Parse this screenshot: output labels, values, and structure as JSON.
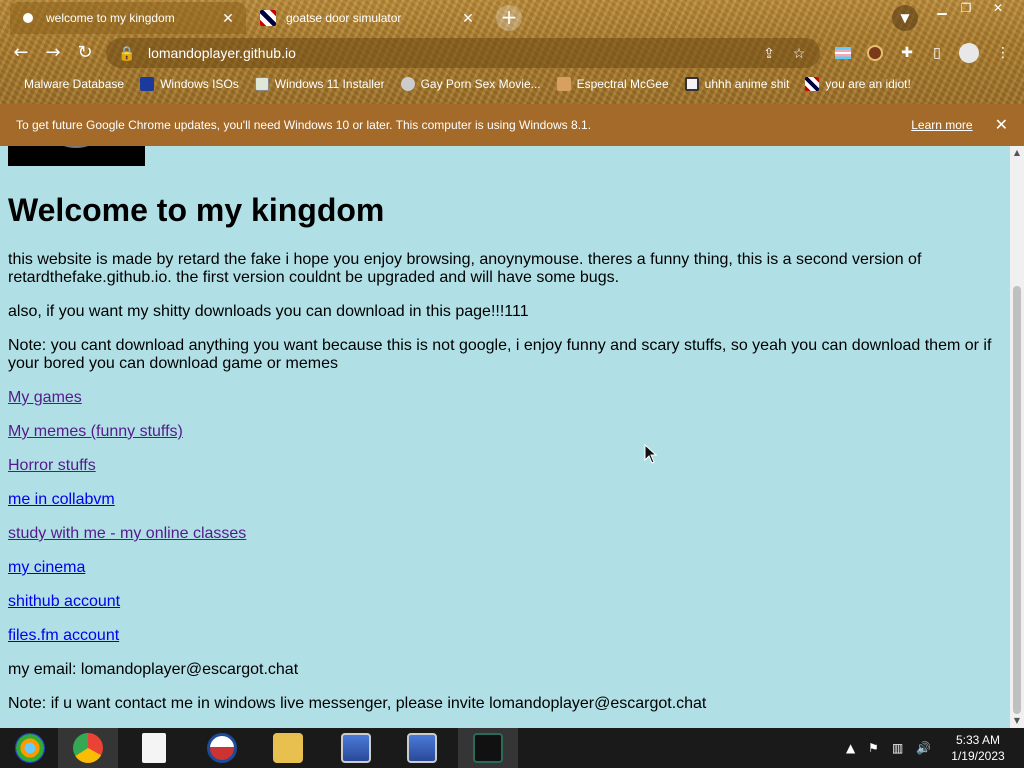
{
  "tabs": [
    {
      "title": "welcome to my kingdom",
      "active": true
    },
    {
      "title": "goatse door simulator",
      "active": false
    }
  ],
  "toolbar": {
    "url": "lomandoplayer.github.io"
  },
  "bookmarks": [
    "Malware Database",
    "Windows ISOs",
    "Windows 11 Installer",
    "Gay Porn Sex Movie...",
    "Espectral McGee",
    "uhhh anime shit",
    "you are an idiot!"
  ],
  "infobar": {
    "message": "To get future Google Chrome updates, you'll need Windows 10 or later. This computer is using Windows 8.1.",
    "learn_more": "Learn more"
  },
  "page": {
    "heading": "Welcome to my kingdom",
    "intro": "this website is made by retard the fake i hope you enjoy browsing, anoynymouse. theres a funny thing, this is a second version of retardthefake.github.io. the first version couldnt be upgraded and will have some bugs.",
    "downloads": "also, if you want my shitty downloads you can download in this page!!!111",
    "note": "Note: you cant download anything you want because this is not google, i enjoy funny and scary stuffs, so yeah you can download them or if your bored you can download game or memes",
    "links": [
      {
        "label": "My games",
        "visited": true
      },
      {
        "label": "My memes (funny stuffs)",
        "visited": true
      },
      {
        "label": "Horror stuffs",
        "visited": true
      },
      {
        "label": "me in collabvm",
        "visited": false
      },
      {
        "label": "study with me - my online classes",
        "visited": true
      },
      {
        "label": "my cinema",
        "visited": false
      },
      {
        "label": "shithub account",
        "visited": false
      },
      {
        "label": "files.fm account",
        "visited": false
      }
    ],
    "email": "my email: lomandoplayer@escargot.chat",
    "messenger_note": "Note: if u want contact me in windows live messenger, please invite lomandoplayer@escargot.chat"
  },
  "taskbar": {
    "time": "5:33 AM",
    "date": "1/19/2023"
  }
}
